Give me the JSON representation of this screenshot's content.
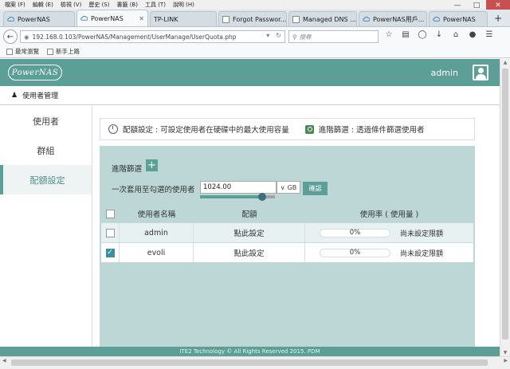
{
  "browser": {
    "menu": [
      "檔案 (F)",
      "編輯 (E)",
      "檢視 (V)",
      "歷史 (S)",
      "書籤 (B)",
      "工具 (T)",
      "說明 (H)"
    ],
    "tabs": [
      {
        "label": "PowerNAS",
        "active": false
      },
      {
        "label": "PowerNAS",
        "active": true
      },
      {
        "label": "TP-LINK",
        "active": false
      },
      {
        "label": "Forgot Passwor...",
        "active": false
      },
      {
        "label": "Managed DNS ...",
        "active": false
      },
      {
        "label": "PowerNAS用戶...",
        "active": false
      },
      {
        "label": "PowerNAS",
        "active": false
      }
    ],
    "url": "192.168.0.103/PowerNAS/Management/UserManage/UserQuota.php",
    "search_placeholder": "搜尋",
    "bookmarks": [
      "最常瀏覽",
      "新手上路"
    ]
  },
  "app": {
    "logo_text": "PowerNAS",
    "username": "admin",
    "page_title": "使用者管理",
    "sidebar": [
      {
        "label": "使用者",
        "active": false
      },
      {
        "label": "群組",
        "active": false
      },
      {
        "label": "配額設定",
        "active": true
      }
    ],
    "info": {
      "quota_text": "配額設定 : 可設定使用者在硬碟中的最大使用容量",
      "filter_text": "進階篩選 : 透過條件篩選使用者"
    },
    "panel": {
      "adv_filter_label": "進階篩選",
      "apply_label": "一次套用至勾選的使用者",
      "quota_value": "1024.00",
      "unit": "GB",
      "slider_level": 0.83,
      "confirm_label": "確認"
    },
    "table": {
      "headers": {
        "name": "使用者名稱",
        "quota": "配額",
        "usage": "使用率 ( 使用量 )"
      },
      "rows": [
        {
          "name": "admin",
          "quota": "點此設定",
          "usage": "0%",
          "usage_fraction": 0,
          "note": "尚未設定限額",
          "checked": false
        },
        {
          "name": "evoli",
          "quota": "點此設定",
          "usage": "0%",
          "usage_fraction": 0,
          "note": "尚未設定限額",
          "checked": true
        }
      ]
    },
    "footer": "ITE2 Technology © All Rights Reserved 2015. PDM"
  }
}
